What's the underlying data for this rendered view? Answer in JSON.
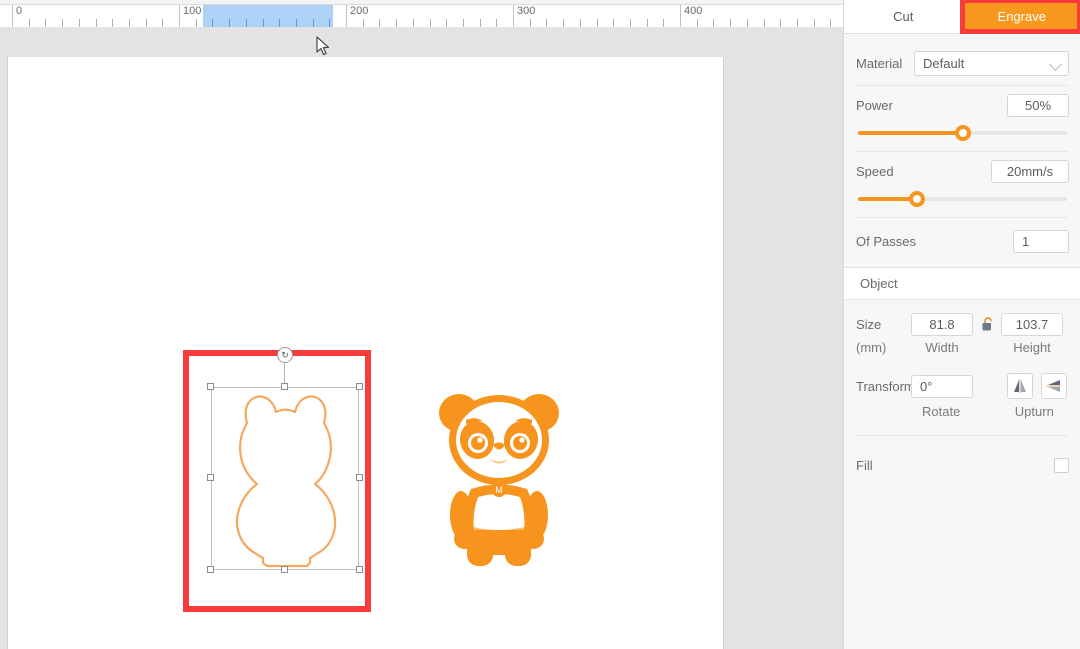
{
  "ruler": {
    "labels": [
      "0",
      "100",
      "200",
      "300",
      "400"
    ],
    "selection_start_label": "100",
    "selection_end_label": "200"
  },
  "panel": {
    "tabs": [
      {
        "label": "Cut",
        "active": false
      },
      {
        "label": "Engrave",
        "active": true
      }
    ],
    "material": {
      "label": "Material",
      "value": "Default",
      "chevron": "chevron-down-icon"
    },
    "power": {
      "label": "Power",
      "value": "50%",
      "slider_percent": 50
    },
    "speed": {
      "label": "Speed",
      "value": "20mm/s",
      "slider_percent": 28
    },
    "passes": {
      "label": "Of Passes",
      "value": "1"
    },
    "object": {
      "header": "Object",
      "size_label": "Size",
      "unit_label": "(mm)",
      "width_value": "81.8",
      "height_value": "103.7",
      "width_label": "Width",
      "height_label": "Height",
      "lock_icon": "unlock-icon",
      "transform_label": "Transform",
      "rotate_value": "0°",
      "rotate_label": "Rotate",
      "upturn_label": "Upturn",
      "flip_vertical_icon": "flip-vertical-icon",
      "flip_horizontal_icon": "flip-horizontal-icon"
    },
    "fill": {
      "label": "Fill",
      "checked": false
    }
  },
  "canvas": {
    "selected_object_name": "bear-outline-shape",
    "artwork_name": "panda-illustration",
    "rotate_handle_label": "↻",
    "accent_color": "#f7941e",
    "shape_stroke_color": "#f5a85e",
    "annotation_color": "#f83c3c",
    "ruler_selection_color": "#aed2f5"
  }
}
